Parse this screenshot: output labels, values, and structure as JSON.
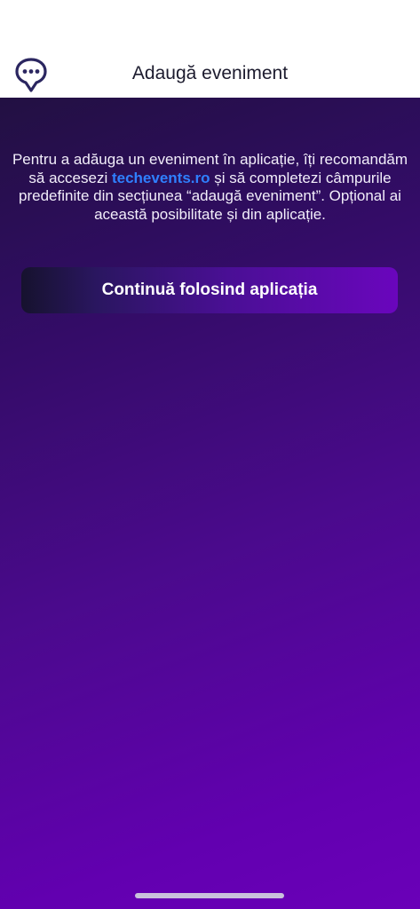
{
  "header": {
    "title": "Adaugă eveniment",
    "logo_icon": "chat-bubble-pin-icon",
    "logo_color": "#2b2660"
  },
  "intro": {
    "text_before": "Pentru a adăuga un eveniment în aplicație, îți recomandăm să accesezi ",
    "link_text": "techevents.ro",
    "text_after": " și să completezi câmpurile predefinite din secțiunea “adaugă eveniment”. Opțional ai această posibilitate și din aplicație."
  },
  "continue_button": {
    "label": "Continuă folosind aplicația"
  },
  "colors": {
    "accent_link": "#2f80ff",
    "background_top": "#221042",
    "background_bottom": "#6a00b8"
  }
}
